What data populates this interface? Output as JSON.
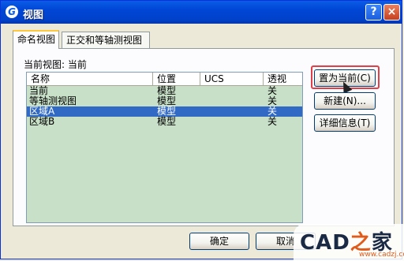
{
  "window": {
    "title": "视图",
    "help_icon": "?",
    "close_icon": "×"
  },
  "tabs": [
    {
      "label": "命名视图",
      "active": true
    },
    {
      "label": "正交和等轴测视图",
      "active": false
    }
  ],
  "current_view_label": "当前视图: 当前",
  "list": {
    "columns": [
      "名称",
      "位置",
      "UCS",
      "透视"
    ],
    "rows": [
      {
        "name": "当前",
        "location": "模型",
        "ucs": "",
        "perspective": "关",
        "selected": false
      },
      {
        "name": "等轴测视图",
        "location": "模型",
        "ucs": "",
        "perspective": "关",
        "selected": false
      },
      {
        "name": "区域A",
        "location": "模型",
        "ucs": "",
        "perspective": "关",
        "selected": true
      },
      {
        "name": "区域B",
        "location": "模型",
        "ucs": "",
        "perspective": "关",
        "selected": false
      }
    ]
  },
  "buttons": {
    "set_current": "置为当前(C)",
    "new": "新建(N)...",
    "details": "详细信息(T)",
    "ok": "确定",
    "cancel": "取消"
  },
  "watermark": {
    "logo": "CAD",
    "logo_accent": "之",
    "logo_tail": "家",
    "url": "www.cadzj.com"
  },
  "colors": {
    "selection": "#316ac5",
    "list_background": "#c8e0c8",
    "highlight_box": "#e0404a"
  }
}
